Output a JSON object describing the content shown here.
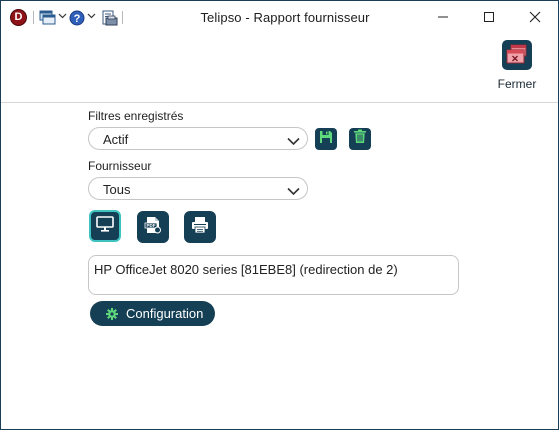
{
  "window": {
    "title": "Telipso - Rapport fournisseur",
    "app_icon_letter": "D",
    "controls": {
      "minimize": "minimize-icon",
      "maximize": "maximize-icon",
      "close": "close-icon"
    }
  },
  "quick_access": {
    "icons": [
      "windows-icon",
      "help-icon",
      "report-icon"
    ]
  },
  "toolbar": {
    "close_label": "Fermer"
  },
  "filters": {
    "label": "Filtres enregistrés",
    "selected": "Actif",
    "save_icon": "floppy-disk-icon",
    "delete_icon": "trash-icon"
  },
  "supplier": {
    "label": "Fournisseur",
    "selected": "Tous"
  },
  "output": {
    "options": [
      "screen-icon",
      "pdf-icon",
      "printer-icon"
    ],
    "selected": "screen-icon"
  },
  "printer": {
    "value": "HP OfficeJet 8020 series [81EBE8] (redirection de 2)"
  },
  "configuration": {
    "label": "Configuration"
  },
  "colors": {
    "accent": "#153f55",
    "highlight": "#3fc3c0",
    "icon_green": "#5ed97b",
    "close_red": "#d74a57"
  }
}
